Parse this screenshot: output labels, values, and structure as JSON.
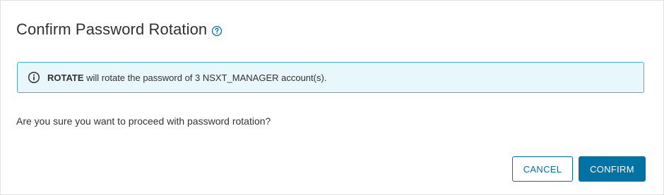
{
  "dialog": {
    "title": "Confirm Password Rotation",
    "help_icon": "help-circle-icon"
  },
  "alert": {
    "icon": "info-circle-icon",
    "strong_text": "ROTATE",
    "message": " will rotate the password of 3 NSXT_MANAGER account(s).",
    "border_color": "#49afd9",
    "background_color": "#e8f7fc"
  },
  "body": {
    "question": "Are you sure you want to proceed with password rotation?"
  },
  "footer": {
    "cancel_label": "CANCEL",
    "confirm_label": "CONFIRM",
    "primary_color": "#0072a3"
  }
}
